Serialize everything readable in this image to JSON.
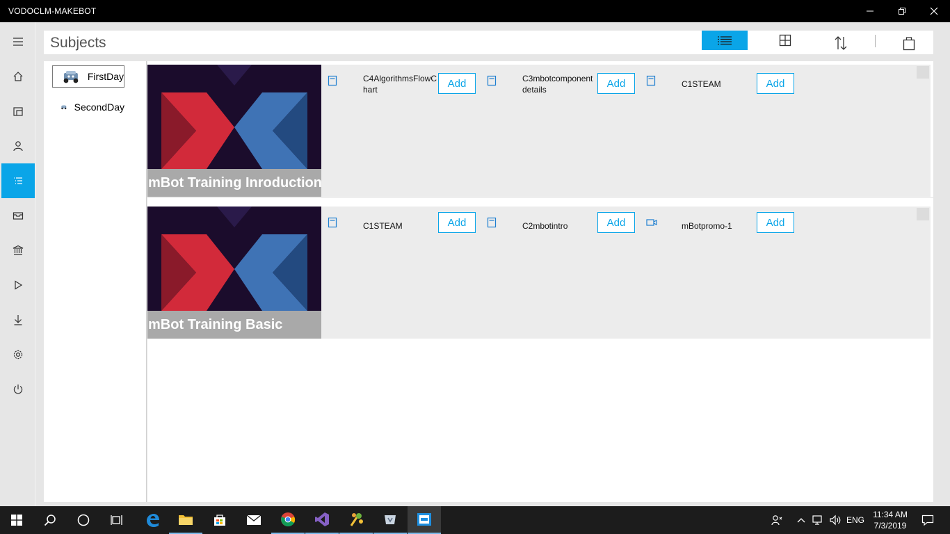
{
  "window": {
    "title": "VODOCLM-MAKEBOT"
  },
  "nav": {
    "items": [
      {
        "name": "menu",
        "icon": "hamburger-icon"
      },
      {
        "name": "home",
        "icon": "home-icon"
      },
      {
        "name": "library",
        "icon": "library-icon"
      },
      {
        "name": "profile",
        "icon": "person-icon"
      },
      {
        "name": "subjects",
        "icon": "list-icon",
        "active": true
      },
      {
        "name": "inbox",
        "icon": "inbox-icon"
      },
      {
        "name": "institution",
        "icon": "bank-icon"
      },
      {
        "name": "play",
        "icon": "play-icon"
      },
      {
        "name": "downloads",
        "icon": "download-icon"
      },
      {
        "name": "settings",
        "icon": "gear-icon"
      },
      {
        "name": "power",
        "icon": "power-icon"
      }
    ]
  },
  "header": {
    "title": "Subjects",
    "buttons": [
      "list-view-icon",
      "grid-view-icon",
      "sort-icon",
      "bag-icon"
    ]
  },
  "days": [
    {
      "label": "FirstDay",
      "selected": true
    },
    {
      "label": "SecondDay",
      "selected": false
    }
  ],
  "subjects": [
    {
      "title": "mBot Training Inroduction",
      "resources": [
        {
          "type": "document-icon",
          "name": "C4AlgorithmsFlowChart",
          "button": "Add"
        },
        {
          "type": "document-icon",
          "name": "C3mbotcomponentdetails",
          "button": "Add"
        },
        {
          "type": "document-icon",
          "name": "C1STEAM",
          "button": "Add"
        }
      ]
    },
    {
      "title": "mBot Training Basic",
      "resources": [
        {
          "type": "document-icon",
          "name": "C1STEAM",
          "button": "Add"
        },
        {
          "type": "document-icon",
          "name": "C2mbotintro",
          "button": "Add"
        },
        {
          "type": "video-icon",
          "name": "mBotpromo-1",
          "button": "Add"
        }
      ]
    }
  ],
  "taskbar": {
    "apps": [
      "start-icon",
      "search-icon",
      "cortana-icon",
      "task-view-icon",
      "edge-icon",
      "file-explorer-icon",
      "store-icon",
      "mail-icon",
      "chrome-icon",
      "visual-studio-icon",
      "paint-app-icon",
      "tool-app-icon",
      "makebot-app-icon"
    ],
    "language": "ENG",
    "time": "11:34 AM",
    "date": "7/3/2019"
  },
  "colors": {
    "accent": "#0aa5e8",
    "titlebar": "#000000",
    "taskbar": "#1c1c1c"
  }
}
